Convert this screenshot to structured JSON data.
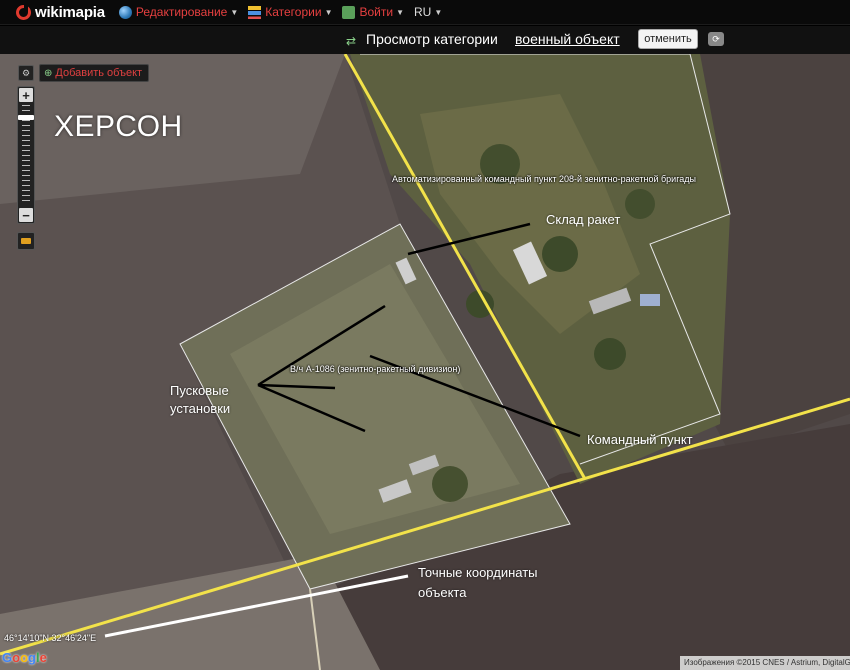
{
  "header": {
    "logo_text": "wikimapia",
    "menus": [
      {
        "label": "Редактирование",
        "icon": "globe-icon"
      },
      {
        "label": "Категории",
        "icon": "categories-icon"
      },
      {
        "label": "Войти",
        "icon": "login-icon"
      },
      {
        "label": "RU",
        "icon": ""
      }
    ]
  },
  "category_bar": {
    "title": "Просмотр категории",
    "category_link": "военный объект",
    "cancel_label": "отменить"
  },
  "map": {
    "add_object_label": "Добавить объект",
    "city_label": "ХЕРСОН",
    "object_labels": {
      "command_post": "Автоматизированный командный пункт 208-й зенитно-ракетной бригады",
      "unit": "В/ч А-1086 (зенитно-ракетный дивизион)"
    },
    "annotations": {
      "missile_depot": "Склад ракет",
      "launchers_line1": "Пусковые",
      "launchers_line2": "установки",
      "command_point": "Командный пункт",
      "exact_coords_line1": "Точные координаты",
      "exact_coords_line2": "объекта"
    },
    "coordinates": "46°14'10\"N 32°46'24\"E",
    "google_logo": "Google",
    "credits": "Изображения ©2015 CNES / Astrium, DigitalGlobe, Eu"
  },
  "colors": {
    "road_yellow": "#f2e24a",
    "accent_red": "#e64040",
    "field_dark": "#4f4644",
    "field_light": "#7a7470"
  }
}
